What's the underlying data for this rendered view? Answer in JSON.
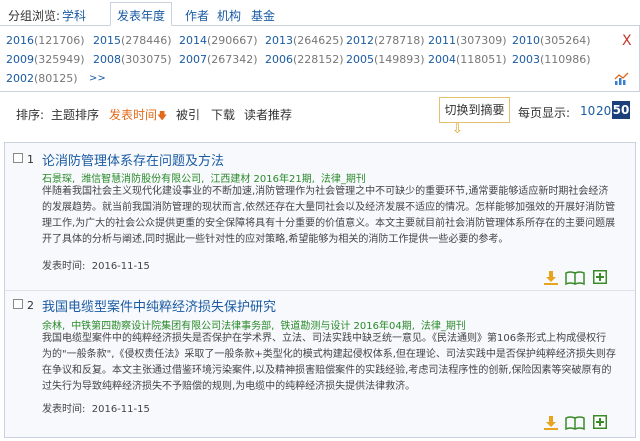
{
  "group_nav": {
    "label": "分组浏览:",
    "tabs": [
      {
        "label": "学科"
      },
      {
        "label": "发表年度"
      },
      {
        "label": "作者"
      },
      {
        "label": "机构"
      },
      {
        "label": "基金"
      }
    ]
  },
  "years": [
    {
      "year": "2016",
      "count": "(121706)"
    },
    {
      "year": "2015",
      "count": "(278446)"
    },
    {
      "year": "2014",
      "count": "(290667)"
    },
    {
      "year": "2013",
      "count": "(264625)"
    },
    {
      "year": "2012",
      "count": "(278718)"
    },
    {
      "year": "2011",
      "count": "(307309)"
    },
    {
      "year": "2010",
      "count": "(305264)"
    },
    {
      "year": "2009",
      "count": "(325949)"
    },
    {
      "year": "2008",
      "count": "(303075)"
    },
    {
      "year": "2007",
      "count": "(267342)"
    },
    {
      "year": "2006",
      "count": "(228152)"
    },
    {
      "year": "2005",
      "count": "(149893)"
    },
    {
      "year": "2004",
      "count": "(118051)"
    },
    {
      "year": "2003",
      "count": "(110986)"
    },
    {
      "year": "2002",
      "count": "(80125)"
    }
  ],
  "more_label": ">>",
  "close_label": "X",
  "toolbar": {
    "sort_label": "排序:",
    "items": [
      {
        "label": "主题排序"
      },
      {
        "label": "发表时间"
      },
      {
        "label": "被引"
      },
      {
        "label": "下载"
      },
      {
        "label": "读者推荐"
      }
    ],
    "switch_label": "切换到摘要",
    "per_page_label": "每页显示:",
    "per_page_options": [
      "10",
      "20",
      "50"
    ]
  },
  "records": [
    {
      "number": "1",
      "title": "论消防管理体系存在问题及方法",
      "author": "石景琛,",
      "org": "潍信智慧消防股份有限公司,",
      "journal_issue": "江西建材 2016年21期,",
      "type": "法律_期刊",
      "abstract": "伴随着我国社会主义现代化建设事业的不断加速,消防管理作为社会管理之中不可缺少的重要环节,通常要能够适应新时期社会经济的发展趋势。就当前我国消防管理的现状而言,依然还存在大量同社会以及经济发展不适应的情况。怎样能够加强效的开展好消防管理工作,为广大的社会公众提供更重的安全保障将具有十分重要的价值意义。本文主要就目前社会消防管理体系所存在的主要问题展开了具体的分析与阐述,同时据此一些针对性的应对策略,希望能够为相关的消防工作提供一些必要的参考。",
      "date_label": "发表时间:",
      "date": "2016-11-15"
    },
    {
      "number": "2",
      "title": "我国电缆型案件中纯粹经济损失保护研究",
      "author": "余林,",
      "org": "中铁第四勘察设计院集团有限公司法律事务部,",
      "journal_issue": "铁道勘测与设计 2016年04期,",
      "type": "法律_期刊",
      "abstract": "我国电缆型案件中的纯粹经济损失是否保护在学术界、立法、司法实践中缺乏统一意见。《民法通则》第106条形式上构成侵权行为的\"一般条款\",《侵权责任法》采取了一般条款+类型化的模式构建起侵权体系,但在理论、司法实践中是否保护纯粹经济损失则存在争议和反复。本文主张通过借鉴环境污染案件,以及精神损害赔偿案件的实践经验,考虑司法程序性的创新,保险因素等突破原有的过失行为导致纯粹经济损失不予赔偿的规则,为电缆中的纯粹经济损失提供法律救济。",
      "date_label": "发表时间:",
      "date": "2016-11-15"
    }
  ]
}
